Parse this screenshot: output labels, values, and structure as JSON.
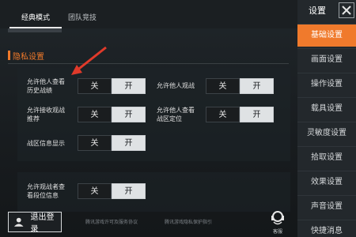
{
  "tabs": [
    {
      "label": "经典模式",
      "active": true
    },
    {
      "label": "团队竞技",
      "active": false
    }
  ],
  "section": {
    "title": "隐私设置"
  },
  "toggle_labels": {
    "off": "关",
    "on": "开"
  },
  "options": [
    {
      "label": "允许他人查看\n历史战绩",
      "value": "开"
    },
    {
      "label": "允许他人观战",
      "value": "开"
    },
    {
      "label": "允许接收观战\n推荐",
      "value": "开"
    },
    {
      "label": "允许他人查看\n战区定位",
      "value": "开"
    },
    {
      "label": "战区信息显示",
      "value": "开"
    },
    {
      "label": "允许观战者查\n看段位信息",
      "value": "开"
    }
  ],
  "sidebar": {
    "title": "设置",
    "close_icon": "close-icon",
    "items": [
      {
        "label": "基础设置",
        "active": true
      },
      {
        "label": "画面设置",
        "active": false
      },
      {
        "label": "操作设置",
        "active": false
      },
      {
        "label": "载具设置",
        "active": false
      },
      {
        "label": "灵敏度设置",
        "active": false
      },
      {
        "label": "拾取设置",
        "active": false
      },
      {
        "label": "效果设置",
        "active": false
      },
      {
        "label": "声音设置",
        "active": false
      },
      {
        "label": "快捷消息",
        "active": false
      }
    ]
  },
  "footer": {
    "logout_label": "退出登录",
    "link1": "腾讯游戏许可及服务协议",
    "link2": "腾讯游戏隐私保护指引",
    "voice_label": "客服"
  },
  "colors": {
    "accent": "#f07a2c",
    "arrow": "#e03a2a"
  }
}
